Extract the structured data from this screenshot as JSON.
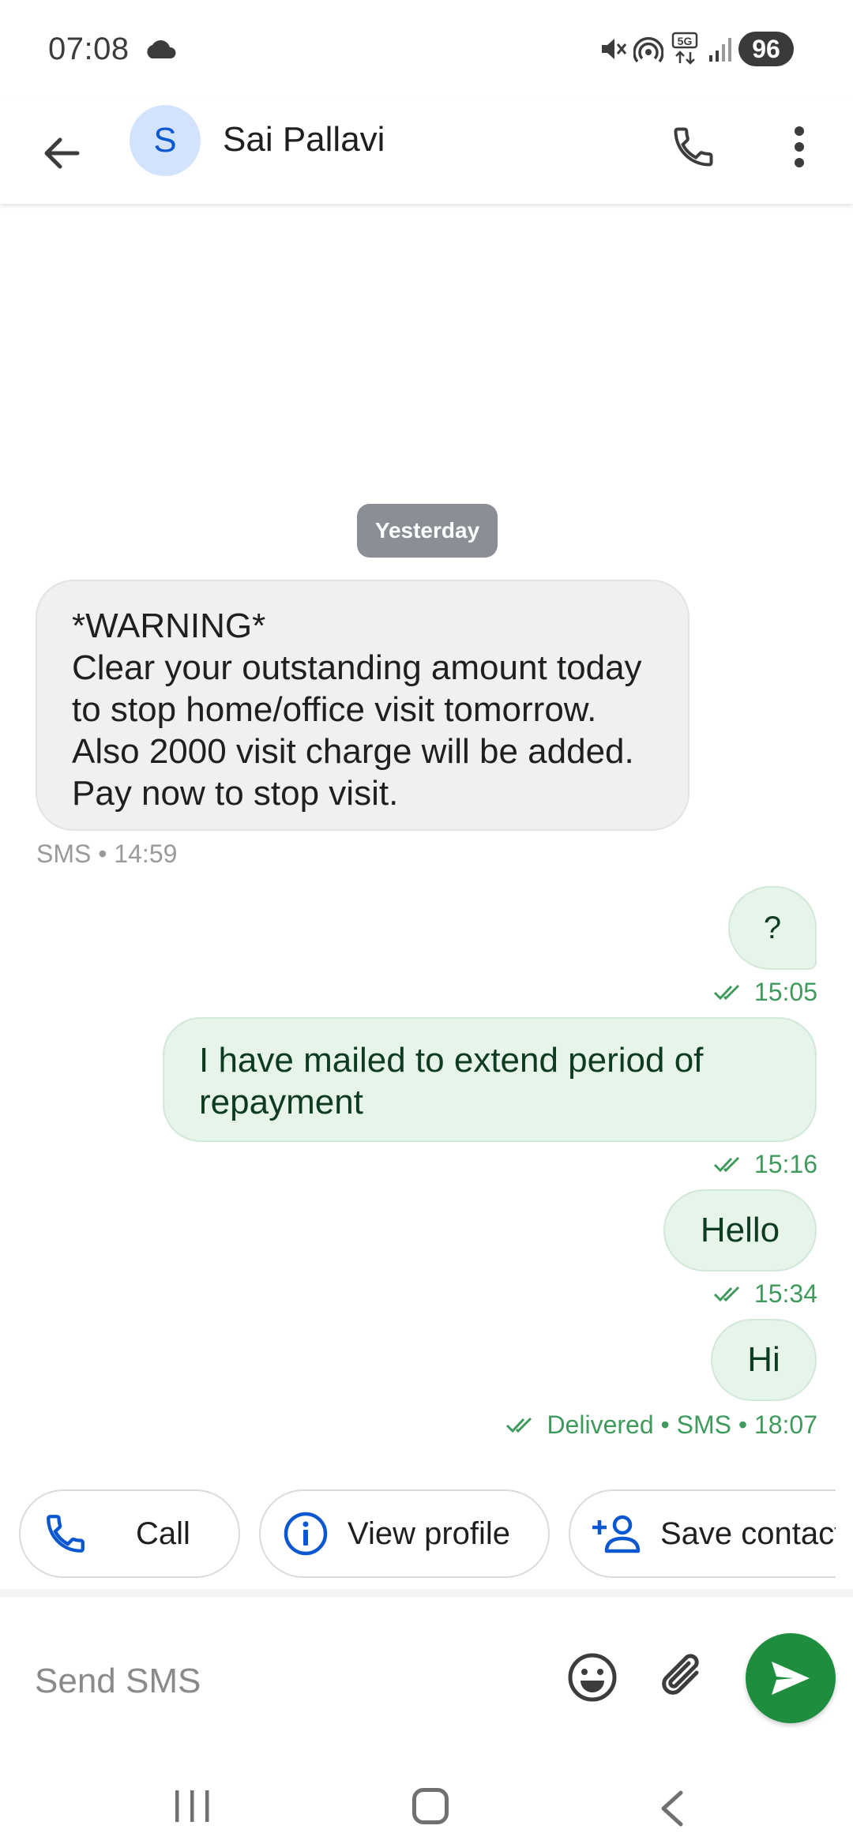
{
  "status_bar": {
    "time": "07:08",
    "network": "5G",
    "battery": "96",
    "icons": [
      "cloud-icon",
      "mute-icon",
      "hotspot-icon",
      "network-5g-icon",
      "signal-icon"
    ]
  },
  "app_bar": {
    "avatar_letter": "S",
    "contact_name": "Sai Pallavi",
    "icons": [
      "back-arrow-icon",
      "phone-icon",
      "more-vert-icon"
    ]
  },
  "conversation": {
    "date_chip": "Yesterday",
    "incoming": {
      "text": "*WARNING*\nClear your outstanding amount today to stop home/office visit tomorrow. Also 2000 visit charge will be added. Pay now to stop visit.",
      "meta": "SMS • 14:59"
    },
    "outgoing": [
      {
        "text": "?",
        "meta": "15:05"
      },
      {
        "text": "I have mailed to extend period of repayment",
        "meta": "15:16"
      },
      {
        "text": "Hello",
        "meta": "15:34"
      },
      {
        "text": "Hi",
        "meta": "Delivered • SMS • 18:07"
      }
    ]
  },
  "actions": {
    "call": "Call",
    "view_profile": "View profile",
    "save_contact": "Save contact"
  },
  "compose": {
    "placeholder": "Send SMS"
  },
  "colors": {
    "accent_blue": "#0b57d0",
    "send_green": "#1e8e3e",
    "outgoing_bubble": "#e6f4ea",
    "incoming_bubble": "#eff0f0",
    "status_green": "#3f9a5c"
  }
}
